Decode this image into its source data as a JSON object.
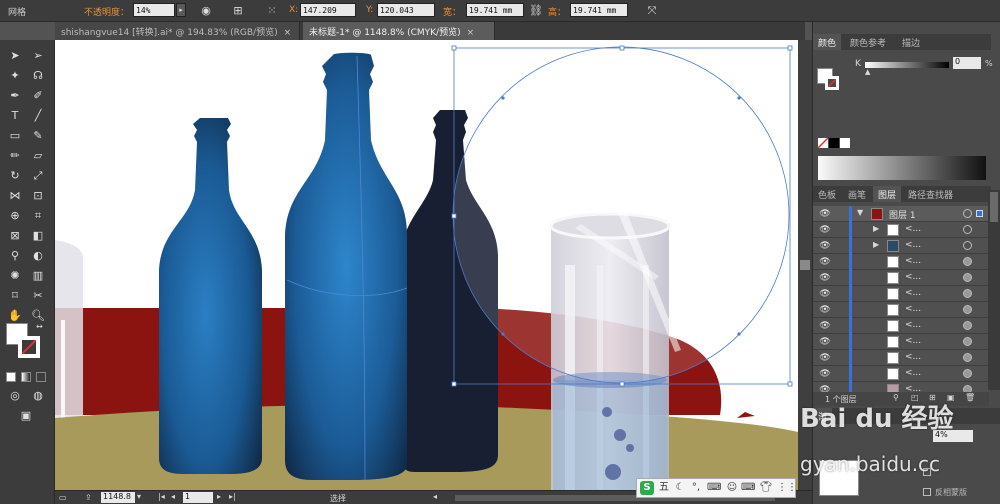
{
  "control_bar": {
    "workspace_label": "网格",
    "opacity_label": "不透明度：",
    "opacity_value": "14%",
    "x_label": "X:",
    "x_value": "147.209 ",
    "y_label": "Y:",
    "y_value": "120.043 ",
    "w_label": "宽：",
    "w_value": "19.741 mm",
    "h_label": "高：",
    "h_value": "19.741 mm"
  },
  "tabs": [
    {
      "label": "shishangvue14 [转换].ai* @ 194.83% (RGB/预览)",
      "active": false
    },
    {
      "label": "未标题-1* @ 1148.8% (CMYK/预览)",
      "active": true
    }
  ],
  "color_panel": {
    "tabs": [
      "颜色",
      "颜色参考",
      "描边"
    ],
    "channel_label": "K",
    "channel_value": "0",
    "channel_unit": "%"
  },
  "layers_panel": {
    "tabs": [
      "色板",
      "画笔",
      "图层",
      "路径查找器"
    ],
    "top_layer_name": "图层 1",
    "rows": [
      {
        "name": "<...",
        "thumb": "#ffffff"
      },
      {
        "name": "<...",
        "thumb": "#2a4a6a"
      },
      {
        "name": "<...",
        "thumb": "#ffffff"
      },
      {
        "name": "<...",
        "thumb": "#ffffff"
      },
      {
        "name": "<...",
        "thumb": "#ffffff"
      },
      {
        "name": "<...",
        "thumb": "#ffffff"
      },
      {
        "name": "<...",
        "thumb": "#ffffff"
      },
      {
        "name": "<...",
        "thumb": "#ffffff"
      },
      {
        "name": "<...",
        "thumb": "#ffffff"
      },
      {
        "name": "<...",
        "thumb": "#ffffff"
      },
      {
        "name": "<...",
        "thumb": "#b89aa8"
      }
    ],
    "footer_count": "1 个图层"
  },
  "bottom_panel": {
    "tab_label": "渐",
    "percent_value": "4%",
    "invert_mask_label": "反相蒙版"
  },
  "status_bar": {
    "zoom_value": "1148.8",
    "page_value": "1",
    "status_text": "选择"
  },
  "ime": {
    "logo": "S",
    "mode": "五"
  },
  "watermark": {
    "line1": "Bai du 经验",
    "line2": "gyan.baidu.cc"
  },
  "colors": {
    "ui_dark": "#3c3c3c",
    "panel": "#4a4a4a",
    "accent_orange": "#e8903a",
    "bottle_blue": "#1c5e94",
    "bottle_dark": "#1a2236",
    "table_olive": "#a89a5a",
    "cloth_red": "#8c1410",
    "selection_blue": "#4a7ac8"
  }
}
